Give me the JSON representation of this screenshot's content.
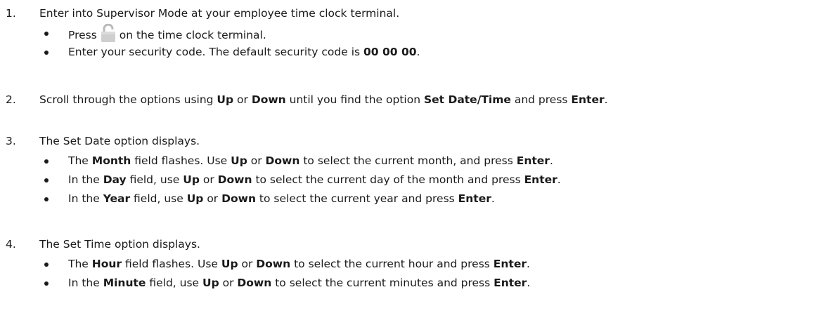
{
  "steps": [
    {
      "number": "1.",
      "text": "Enter into Supervisor Mode at your employee time clock terminal.",
      "bullets": [
        {
          "parts": [
            "Press",
            "on the time clock terminal."
          ],
          "icon": "unlock-icon"
        },
        {
          "parts": [
            "Enter your security code. The default security code is ",
            "00 00 00",
            "."
          ]
        }
      ]
    },
    {
      "number": "2.",
      "parts": [
        "Scroll through the options using ",
        "Up",
        " or ",
        "Down",
        " until you find the option ",
        "Set Date/Time",
        " and press ",
        "Enter",
        "."
      ]
    },
    {
      "number": "3.",
      "text": "The Set Date option displays.",
      "bullets": [
        {
          "parts": [
            "The ",
            "Month",
            " field flashes. Use ",
            "Up",
            " or ",
            "Down",
            " to select the current month, and press ",
            "Enter",
            "."
          ]
        },
        {
          "parts": [
            "In the ",
            "Day",
            " field, use ",
            "Up",
            " or ",
            "Down",
            " to select the current day of the month and press ",
            "Enter",
            "."
          ]
        },
        {
          "parts": [
            "In the ",
            "Year",
            " field, use ",
            "Up",
            " or ",
            "Down",
            " to select the current year and press ",
            "Enter",
            "."
          ]
        }
      ]
    },
    {
      "number": "4.",
      "text": "The Set Time option displays.",
      "bullets": [
        {
          "parts": [
            "The ",
            "Hour",
            " field flashes. Use ",
            "Up",
            " or ",
            "Down",
            " to select the current hour and press ",
            "Enter",
            "."
          ]
        },
        {
          "parts": [
            "In the ",
            "Minute",
            " field, use ",
            "Up",
            " or ",
            "Down",
            " to select the current minutes and press ",
            "Enter",
            "."
          ]
        }
      ]
    }
  ]
}
